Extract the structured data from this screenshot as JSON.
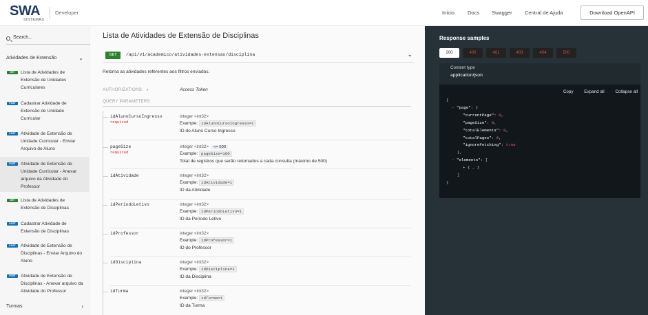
{
  "header": {
    "logo_main": "SWA",
    "logo_sub": "SISTEMAS",
    "brand_tag": "Developer",
    "nav": [
      "Início",
      "Docs",
      "Swagger",
      "Central de Ajuda"
    ],
    "download_button": "Download OpenAPI"
  },
  "sidebar": {
    "search_placeholder": "Search...",
    "group_open": "Atividades de Extensão",
    "items": [
      {
        "method": "GET",
        "label": "Lista de Atividades de Extensão de Unidades Curriculares",
        "active": false
      },
      {
        "method": "POST",
        "label": "Cadastrar Atividade de Extensão de Unidade Curricular",
        "active": false
      },
      {
        "method": "POST",
        "label": "Atividade de Extensão de Unidade Curricular - Enviar Arquivo do Aluno",
        "active": false
      },
      {
        "method": "POST",
        "label": "Atividade de Extensão de Unidade Curricular - Anexar arquivo da Atividade do Professor",
        "active": true
      },
      {
        "method": "GET",
        "label": "Lista de Atividades de Extensão de Disciplinas",
        "active": false
      },
      {
        "method": "POST",
        "label": "Cadastrar Atividade de Extensão de Disciplinas",
        "active": false
      },
      {
        "method": "POST",
        "label": "Atividade de Extensão de Disciplinas - Enviar Arquivo do Aluno",
        "active": false
      },
      {
        "method": "POST",
        "label": "Atividade de Extensão de Disciplinas - Anexar arquivo da Atividade do Professor",
        "active": false
      }
    ],
    "group_closed": "Turmas"
  },
  "operation": {
    "title": "Lista de Atividades de Extensão de Disciplinas",
    "method": "GET",
    "path": "/api/v1/academico/atividades-extensao/disciplina",
    "description": "Retorna as atividades referentes aos filtros enviados.",
    "authorizations_label": "AUTHORIZATIONS:",
    "authorizations_value": "Access Token",
    "query_params_label": "QUERY PARAMETERS",
    "params": [
      {
        "name": "idAlunoCursoIngresso",
        "required": "required",
        "type": "integer <int32>",
        "constraint": "",
        "example_label": "Example:",
        "example": "idAlunoCursoIngresso=1",
        "description": "ID do Aluno Curso Ingresso"
      },
      {
        "name": "pageSize",
        "required": "required",
        "type": "integer <int32>",
        "constraint": "<= 500",
        "example_label": "Example:",
        "example": "pageSize=100",
        "description": "Total de registros que serão retornados a cada consulta (máximo de 500)"
      },
      {
        "name": "idAtividade",
        "required": "",
        "type": "integer <int32>",
        "constraint": "",
        "example_label": "Example:",
        "example": "idAtividade=1",
        "description": "ID da Atividade"
      },
      {
        "name": "idPeriodoLetivo",
        "required": "",
        "type": "integer <int32>",
        "constraint": "",
        "example_label": "Example:",
        "example": "idPeriodoLetivo=1",
        "description": "ID da Período Letivo"
      },
      {
        "name": "idProfessor",
        "required": "",
        "type": "integer <int32>",
        "constraint": "",
        "example_label": "Example:",
        "example": "idProfessor=1",
        "description": "ID do Professor"
      },
      {
        "name": "idDisciplina",
        "required": "",
        "type": "integer <int32>",
        "constraint": "",
        "example_label": "Example:",
        "example": "idDisciplina=1",
        "description": "ID da Disciplina"
      },
      {
        "name": "idTurma",
        "required": "",
        "type": "integer <int32>",
        "constraint": "",
        "example_label": "Example:",
        "example": "idTurma=1",
        "description": "ID da Turma"
      }
    ]
  },
  "response": {
    "title": "Response samples",
    "codes": [
      "200",
      "400",
      "401",
      "403",
      "404",
      "500"
    ],
    "content_type_label": "Content type",
    "content_type_value": "application/json",
    "actions": [
      "Copy",
      "Expand all",
      "Collapse all"
    ],
    "json_lines": [
      {
        "indent": 0,
        "tokens": [
          {
            "c": "t",
            "v": "{"
          }
        ]
      },
      {
        "indent": 1,
        "tokens": [
          {
            "c": "t",
            "v": "- "
          },
          {
            "c": "k",
            "v": "\"page\""
          },
          {
            "c": "t",
            "v": ": {"
          }
        ]
      },
      {
        "indent": 3,
        "tokens": [
          {
            "c": "k",
            "v": "\"currentPage\""
          },
          {
            "c": "t",
            "v": ": "
          },
          {
            "c": "n",
            "v": "0"
          },
          {
            "c": "t",
            "v": ","
          }
        ]
      },
      {
        "indent": 3,
        "tokens": [
          {
            "c": "k",
            "v": "\"pageSize\""
          },
          {
            "c": "t",
            "v": ": "
          },
          {
            "c": "n",
            "v": "0"
          },
          {
            "c": "t",
            "v": ","
          }
        ]
      },
      {
        "indent": 3,
        "tokens": [
          {
            "c": "k",
            "v": "\"totalElements\""
          },
          {
            "c": "t",
            "v": ": "
          },
          {
            "c": "n",
            "v": "0"
          },
          {
            "c": "t",
            "v": ","
          }
        ]
      },
      {
        "indent": 3,
        "tokens": [
          {
            "c": "k",
            "v": "\"totalPages\""
          },
          {
            "c": "t",
            "v": ": "
          },
          {
            "c": "n",
            "v": "0"
          },
          {
            "c": "t",
            "v": ","
          }
        ]
      },
      {
        "indent": 3,
        "tokens": [
          {
            "c": "k",
            "v": "\"ignoreFetching\""
          },
          {
            "c": "t",
            "v": ": "
          },
          {
            "c": "b",
            "v": "true"
          }
        ]
      },
      {
        "indent": 2,
        "tokens": [
          {
            "c": "t",
            "v": "},"
          }
        ]
      },
      {
        "indent": 1,
        "tokens": [
          {
            "c": "t",
            "v": "- "
          },
          {
            "c": "k",
            "v": "\"elements\""
          },
          {
            "c": "t",
            "v": ": ["
          }
        ]
      },
      {
        "indent": 3,
        "tokens": [
          {
            "c": "t",
            "v": "+ { … }"
          }
        ]
      },
      {
        "indent": 2,
        "tokens": [
          {
            "c": "t",
            "v": "]"
          }
        ]
      },
      {
        "indent": 0,
        "tokens": [
          {
            "c": "t",
            "v": "}"
          }
        ]
      }
    ]
  },
  "colors": {
    "get": "#2f8132",
    "post": "#186fb0",
    "required": "#d41f1c",
    "right_panel": "#263238"
  }
}
